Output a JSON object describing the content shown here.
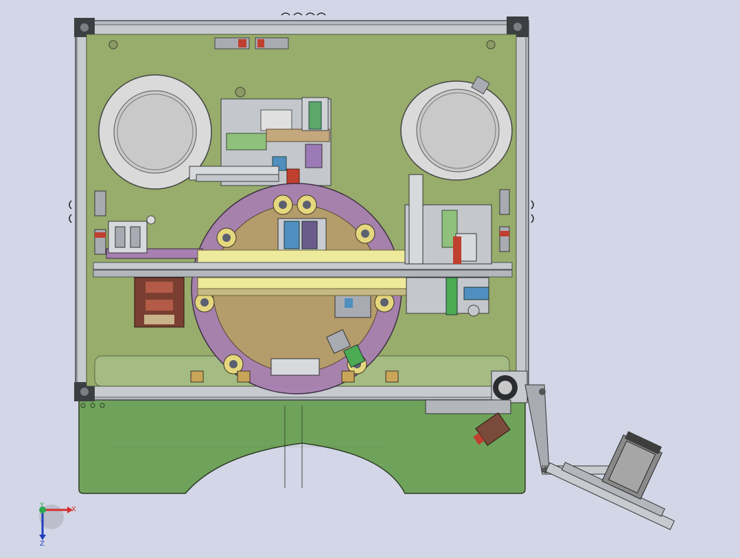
{
  "window": {
    "background": "#d3d6e6"
  },
  "colors": {
    "frame": "#b8bcc2",
    "frame_dark": "#5e6266",
    "plate": "#98ac6c",
    "base": "#6fa35b",
    "turntable": "#a77fb0",
    "turntable_inner": "#b6a064",
    "bowl": "#c9c9c9",
    "beam_yellow": "#eeea9c",
    "motor": "#8a8a8a",
    "accent_blue": "#4f8fbf",
    "accent_red": "#c0402f",
    "accent_green": "#4caa55"
  },
  "parts": [
    "main-frame",
    "top-plate",
    "base-plate",
    "left-feeder-bowl",
    "right-feeder-bowl",
    "rotary-turntable",
    "linear-slide-rail",
    "stepper-motor",
    "hand-wheel",
    "crank-arm"
  ],
  "triad": {
    "x_label": "X",
    "y_label": "Y",
    "z_label": "Z"
  }
}
